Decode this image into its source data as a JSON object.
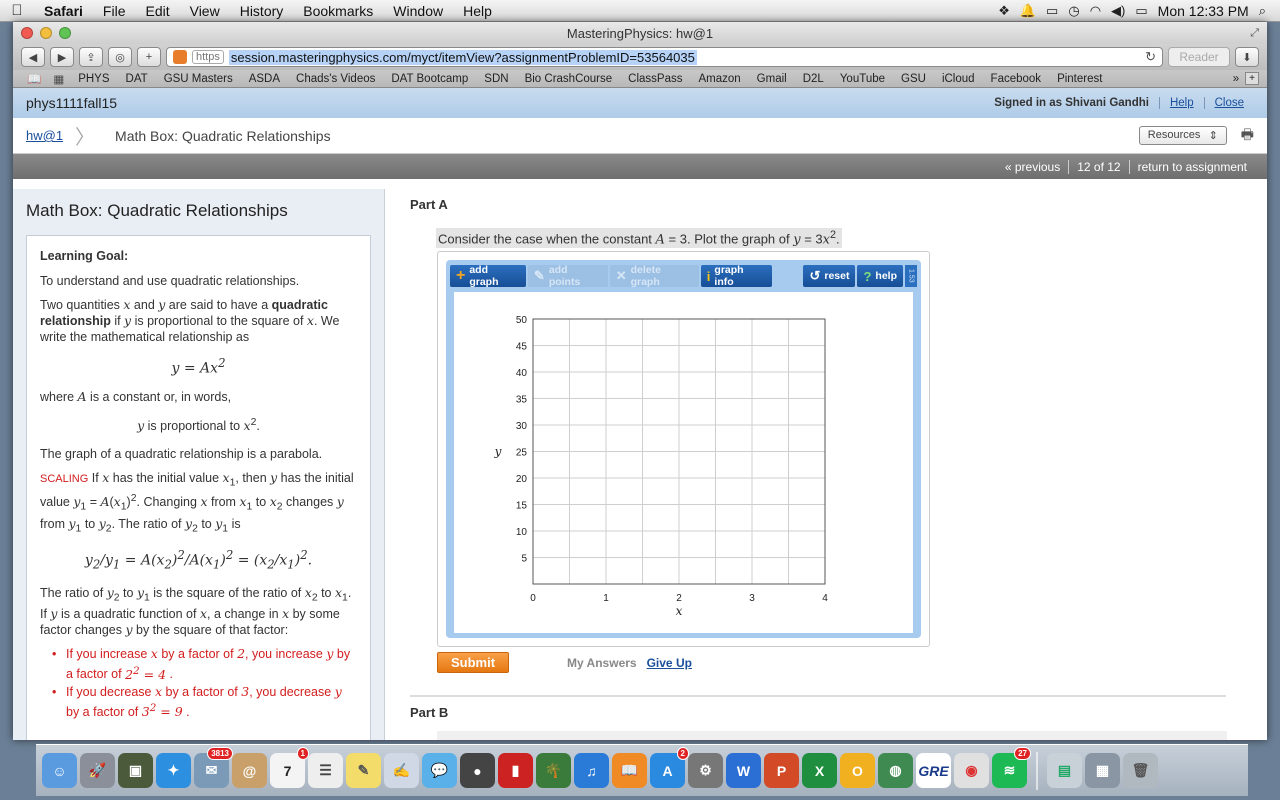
{
  "menubar": {
    "app": "Safari",
    "items": [
      "File",
      "Edit",
      "View",
      "History",
      "Bookmarks",
      "Window",
      "Help"
    ],
    "clock": "Mon 12:33 PM"
  },
  "window": {
    "title": "MasteringPhysics: hw@1"
  },
  "toolbar": {
    "https": "https",
    "url": "session.masteringphysics.com/myct/itemView?assignmentProblemID=53564035",
    "reader": "Reader"
  },
  "bookmarks": [
    "PHYS",
    "DAT",
    "GSU Masters",
    "ASDA",
    "Chads's Videos",
    "DAT Bootcamp",
    "SDN",
    "Bio CrashCourse",
    "ClassPass",
    "Amazon",
    "Gmail",
    "D2L",
    "YouTube",
    "GSU",
    "iCloud",
    "Facebook",
    "Pinterest"
  ],
  "mp": {
    "course": "phys1111fall15",
    "signed_in": "Signed in as Shivani Gandhi",
    "help": "Help",
    "close": "Close",
    "crumb_hw": "hw@1",
    "crumb_title": "Math Box: Quadratic Relationships",
    "resources": "Resources",
    "nav_prev": "« previous",
    "nav_count": "12 of 12",
    "nav_return": "return to assignment"
  },
  "sidebar": {
    "title": "Math Box: Quadratic Relationships",
    "goal_heading": "Learning Goal:",
    "goal_text": "To understand and use quadratic relationships.",
    "where_text": "where",
    "where_rest": "is a constant or, in words,",
    "prop_text": "is proportional to",
    "parabola_text": "The graph of a quadratic relationship is a parabola.",
    "scaling": "SCALING",
    "bullet1a": "If you increase",
    "bullet1b": "by a factor of",
    "bullet1c": ", you increase",
    "bullet1d": "by a factor of",
    "bullet2a": "If you decrease",
    "bullet2b": "by a factor of",
    "bullet2c": ", you decrease",
    "bullet2d": "by a factor of"
  },
  "main": {
    "part_a": "Part A",
    "question_a": "Consider the case when the constant",
    "question_b": ". Plot the graph of",
    "part_b": "Part B",
    "submit": "Submit",
    "my_answers": "My Answers",
    "give_up": "Give Up"
  },
  "graph_tools": {
    "add_graph": "add graph",
    "add_points": "add points",
    "delete_graph": "delete graph",
    "graph_info": "graph info",
    "reset": "reset",
    "help": "help",
    "version": "1.53"
  },
  "chart_data": {
    "type": "line",
    "title": "",
    "xlabel": "x",
    "ylabel": "y",
    "xlim": [
      0,
      4
    ],
    "ylim": [
      0,
      50
    ],
    "x_ticks": [
      0,
      1,
      2,
      3,
      4
    ],
    "y_ticks": [
      5,
      10,
      15,
      20,
      25,
      30,
      35,
      40,
      45,
      50
    ],
    "grid": true,
    "series": []
  },
  "dock": {
    "badge_mail": "3813",
    "badge_cal": "1",
    "badge_store": "2",
    "badge_sp": "27"
  }
}
